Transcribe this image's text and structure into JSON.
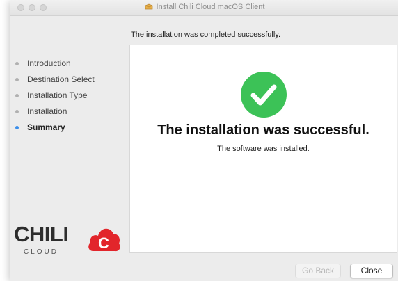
{
  "window": {
    "title": "Install Chili Cloud macOS Client"
  },
  "header": {
    "text": "The installation was completed successfully."
  },
  "sidebar": {
    "steps": [
      {
        "label": "Introduction",
        "active": false
      },
      {
        "label": "Destination Select",
        "active": false
      },
      {
        "label": "Installation Type",
        "active": false
      },
      {
        "label": "Installation",
        "active": false
      },
      {
        "label": "Summary",
        "active": true
      }
    ]
  },
  "logo": {
    "word": "CHILI",
    "sub": "CLOUD",
    "badge_letter": "C"
  },
  "main": {
    "headline": "The installation was successful.",
    "detail": "The software was installed."
  },
  "buttons": {
    "back_label": "Go Back",
    "close_label": "Close"
  },
  "colors": {
    "success_green": "#3cc257",
    "accent_blue": "#3b8eea",
    "brand_red": "#e2252b"
  },
  "icons": {
    "success": "checkmark-icon",
    "title": "package-icon"
  }
}
